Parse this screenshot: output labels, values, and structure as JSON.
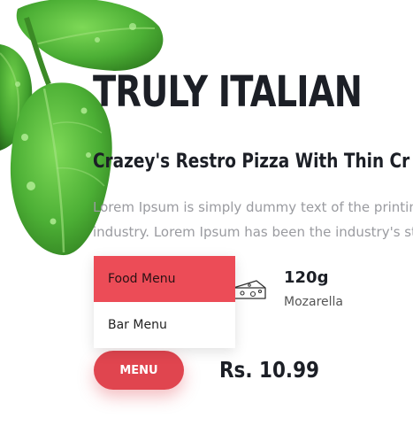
{
  "hero": {
    "title": "TRULY ITALIAN",
    "subtitle": "Crazey's Restro Pizza With Thin Cr",
    "description_lines": [
      "Lorem Ipsum is simply dummy text of the printin",
      "industry. Lorem Ipsum has been the industry's st"
    ]
  },
  "dropdown": {
    "items": [
      {
        "label": "Food Menu",
        "state": "highlighted"
      },
      {
        "label": "Bar Menu",
        "state": "normal"
      }
    ]
  },
  "product": {
    "icon": "cheese-icon",
    "weight": "120g",
    "ingredient": "Mozarella",
    "price": "Rs. 10.99"
  },
  "menu_button": {
    "label": "MENU"
  },
  "colors": {
    "accent": "#e0454f",
    "highlight": "#ec4c57",
    "heading": "#1c1f26",
    "body_text": "#9a9ba0",
    "basil": "#4caf35"
  }
}
